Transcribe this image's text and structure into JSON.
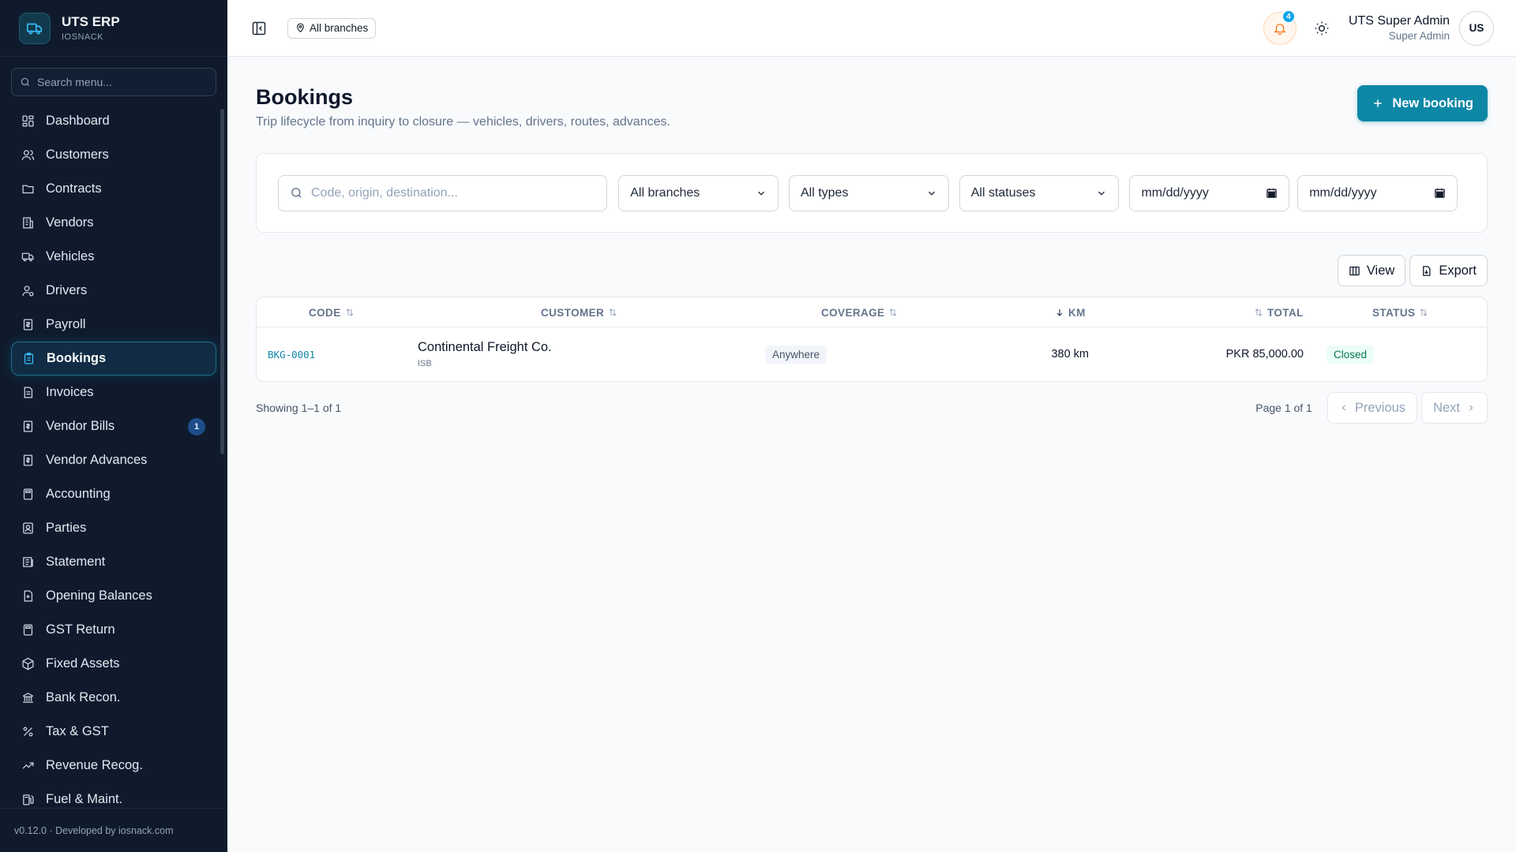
{
  "brand": {
    "title": "UTS ERP",
    "subtitle": "IOSNACK"
  },
  "sidebar": {
    "search_placeholder": "Search menu...",
    "items": [
      {
        "label": "Dashboard",
        "icon": "dashboard-icon"
      },
      {
        "label": "Customers",
        "icon": "users-icon"
      },
      {
        "label": "Contracts",
        "icon": "folder-icon"
      },
      {
        "label": "Vendors",
        "icon": "building-icon"
      },
      {
        "label": "Vehicles",
        "icon": "truck-icon"
      },
      {
        "label": "Drivers",
        "icon": "driver-icon"
      },
      {
        "label": "Payroll",
        "icon": "receipt-icon"
      },
      {
        "label": "Bookings",
        "icon": "clipboard-icon",
        "active": true
      },
      {
        "label": "Invoices",
        "icon": "document-icon"
      },
      {
        "label": "Vendor Bills",
        "icon": "bill-icon",
        "badge": "1"
      },
      {
        "label": "Vendor Advances",
        "icon": "advance-icon"
      },
      {
        "label": "Accounting",
        "icon": "calculator-icon"
      },
      {
        "label": "Parties",
        "icon": "contact-icon"
      },
      {
        "label": "Statement",
        "icon": "statement-icon"
      },
      {
        "label": "Opening Balances",
        "icon": "file-plus-icon"
      },
      {
        "label": "GST Return",
        "icon": "calculator-icon"
      },
      {
        "label": "Fixed Assets",
        "icon": "package-icon"
      },
      {
        "label": "Bank Recon.",
        "icon": "bank-icon"
      },
      {
        "label": "Tax & GST",
        "icon": "percent-icon"
      },
      {
        "label": "Revenue Recog.",
        "icon": "trend-icon"
      },
      {
        "label": "Fuel & Maint.",
        "icon": "fuel-icon"
      }
    ],
    "footer": "v0.12.0 · Developed by iosnack.com"
  },
  "topbar": {
    "branch_chip": "All branches",
    "notifications_count": "4",
    "user_name": "UTS Super Admin",
    "user_role": "Super Admin",
    "avatar_initials": "US"
  },
  "page": {
    "title": "Bookings",
    "subtitle": "Trip lifecycle from inquiry to closure — vehicles, drivers, routes, advances.",
    "new_button": "New booking"
  },
  "filters": {
    "search_placeholder": "Code, origin, destination...",
    "branch": "All branches",
    "type": "All types",
    "status": "All statuses",
    "date_from": "mm/dd/yyyy",
    "date_to": "mm/dd/yyyy"
  },
  "actions": {
    "view": "View",
    "export": "Export"
  },
  "table": {
    "columns": {
      "code": "CODE",
      "customer": "CUSTOMER",
      "coverage": "COVERAGE",
      "km": "KM",
      "total": "TOTAL",
      "status": "STATUS"
    },
    "rows": [
      {
        "code": "BKG-0001",
        "customer": "Continental Freight Co.",
        "customer_sub": "ISB",
        "coverage": "Anywhere",
        "km": "380 km",
        "total": "PKR 85,000.00",
        "status": "Closed"
      }
    ]
  },
  "pagination": {
    "showing": "Showing 1–1 of 1",
    "page_info": "Page 1 of 1",
    "previous": "Previous",
    "next": "Next"
  },
  "colors": {
    "accent": "#0e87a6",
    "sidebar_bg": "#0f1b2d",
    "status_closed": "#047857"
  }
}
